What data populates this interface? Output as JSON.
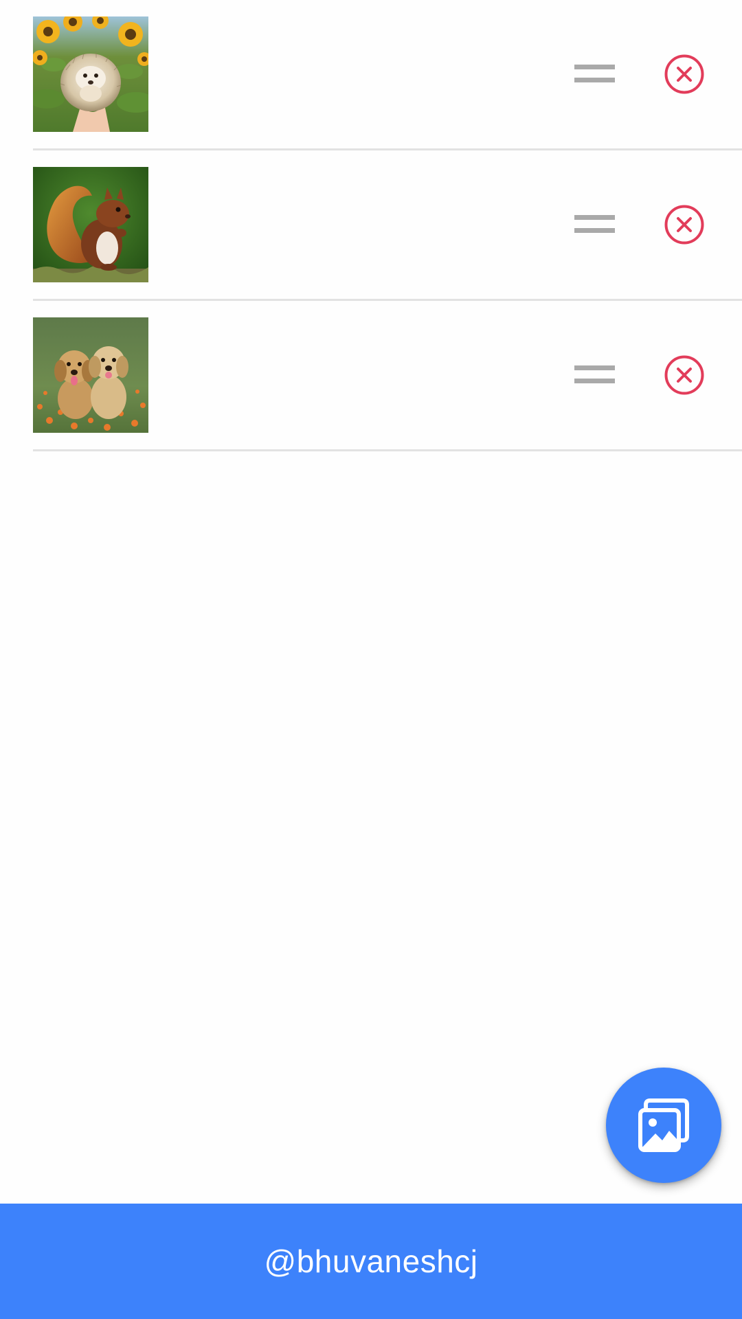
{
  "colors": {
    "accent": "#3d82fb",
    "remove": "#e23c5a",
    "handle": "#a9a9a9",
    "divider": "#e2e2e2",
    "background": "#fefefe"
  },
  "list": {
    "items": [
      {
        "image": "hedgehog-photo",
        "handle_icon": "drag-handle-icon",
        "remove_icon": "close-circle-icon"
      },
      {
        "image": "squirrel-photo",
        "handle_icon": "drag-handle-icon",
        "remove_icon": "close-circle-icon"
      },
      {
        "image": "puppies-photo",
        "handle_icon": "drag-handle-icon",
        "remove_icon": "close-circle-icon"
      }
    ]
  },
  "fab": {
    "icon": "image-gallery-icon"
  },
  "footer": {
    "text": "@bhuvaneshcj"
  }
}
